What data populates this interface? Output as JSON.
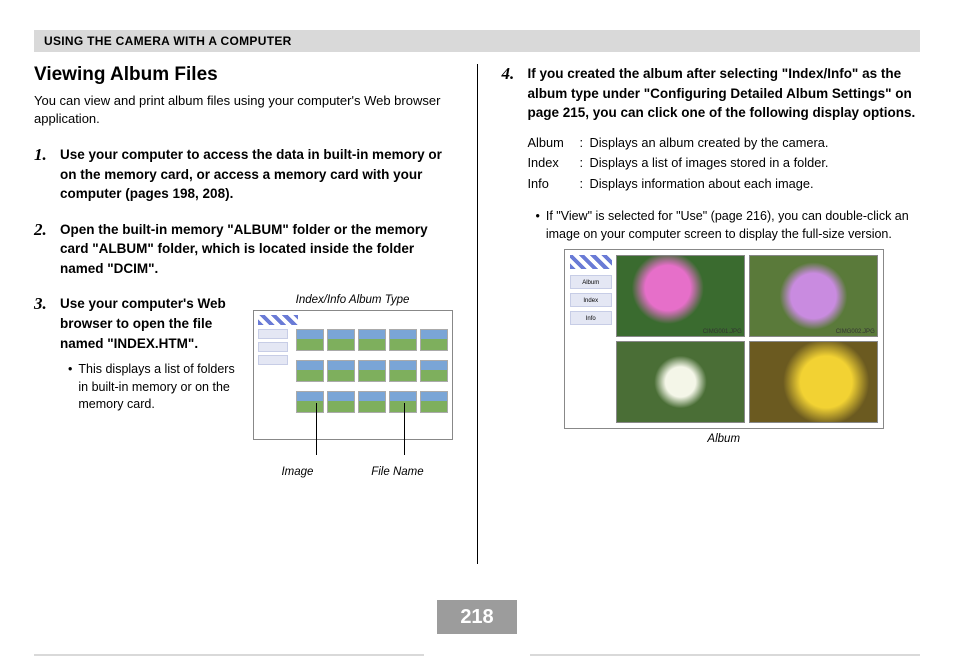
{
  "header": "USING THE CAMERA WITH A COMPUTER",
  "title": "Viewing Album Files",
  "intro": "You can view and print album files using your computer's Web browser application.",
  "steps": {
    "s1": "Use your computer to access the data in built-in memory or on the memory card, or access a memory card with your computer (pages 198, 208).",
    "s2": "Open the built-in memory \"ALBUM\" folder or the memory card \"ALBUM\" folder, which is located inside the folder named \"DCIM\".",
    "s3_text": "Use your computer's Web browser to open the file named \"INDEX.HTM\".",
    "s3_bullet": "This displays a list of folders in built-in memory or on the memory card.",
    "s4": "If you created the album after selecting \"Index/Info\" as the album type under \"Configuring Detailed Album Settings\" on page 215, you can click one of the following display options."
  },
  "defs": {
    "album_term": "Album",
    "album_def": "Displays an album created by the camera.",
    "index_term": "Index",
    "index_def": "Displays a list of images stored in a folder.",
    "info_term": "Info",
    "info_def": "Displays information about each image."
  },
  "s4_bullet": "If \"View\" is selected for \"Use\" (page 216), you can double-click an image on your computer screen to display the full-size version.",
  "fig1": {
    "caption_top": "Index/Info Album Type",
    "label_image": "Image",
    "label_filename": "File Name"
  },
  "fig2": {
    "caption": "Album",
    "btn_album": "Album",
    "btn_index": "Index",
    "btn_info": "Info",
    "fn1": "CIMG001.JPG",
    "fn2": "CIMG002.JPG"
  },
  "page_number": "218"
}
